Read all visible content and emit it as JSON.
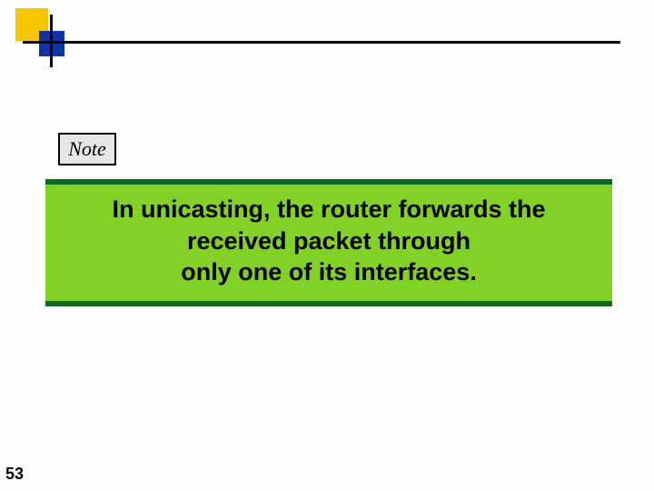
{
  "decor": {
    "colors": {
      "blue": "#1034a6",
      "yellow": "#f7c600"
    }
  },
  "note": {
    "label": "Note"
  },
  "callout": {
    "line1": "In unicasting, the router forwards the",
    "line2": "received packet through",
    "line3": "only one of its interfaces."
  },
  "page": {
    "number": "53"
  }
}
